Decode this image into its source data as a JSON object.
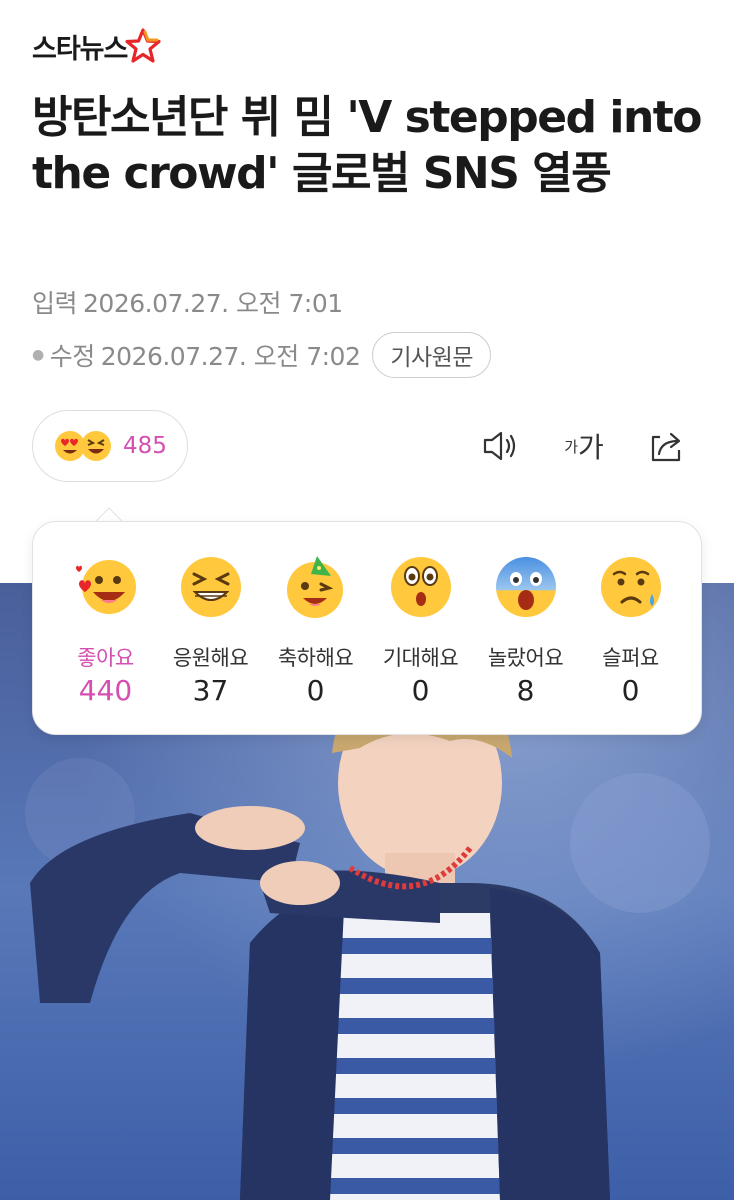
{
  "brand": {
    "logo_text": "스타뉴스"
  },
  "article": {
    "headline": "방탄소년단 뷔 밈 'V stepped into the crowd' 글로벌 SNS 열풍",
    "published_label": "입력",
    "published_date": "2026.07.27. 오전 7:01",
    "modified_label": "수정",
    "modified_date": "2026.07.27. 오전 7:02",
    "original_button": "기사원문"
  },
  "reaction_summary": {
    "count": "485"
  },
  "toolbar": {
    "font_small": "가",
    "font_big": "가"
  },
  "reactions": [
    {
      "label": "좋아요",
      "count": "440",
      "icon": "heart-eyes-emoji"
    },
    {
      "label": "응원해요",
      "count": "37",
      "icon": "grinning-squint-emoji"
    },
    {
      "label": "축하해요",
      "count": "0",
      "icon": "party-hat-emoji"
    },
    {
      "label": "기대해요",
      "count": "0",
      "icon": "anticipating-emoji"
    },
    {
      "label": "놀랐어요",
      "count": "8",
      "icon": "shocked-emoji"
    },
    {
      "label": "슬퍼요",
      "count": "0",
      "icon": "sad-tear-emoji"
    }
  ],
  "colors": {
    "accent_pink": "#d44fb2",
    "logo_red": "#e8262a",
    "logo_orange": "#f39a1e"
  }
}
